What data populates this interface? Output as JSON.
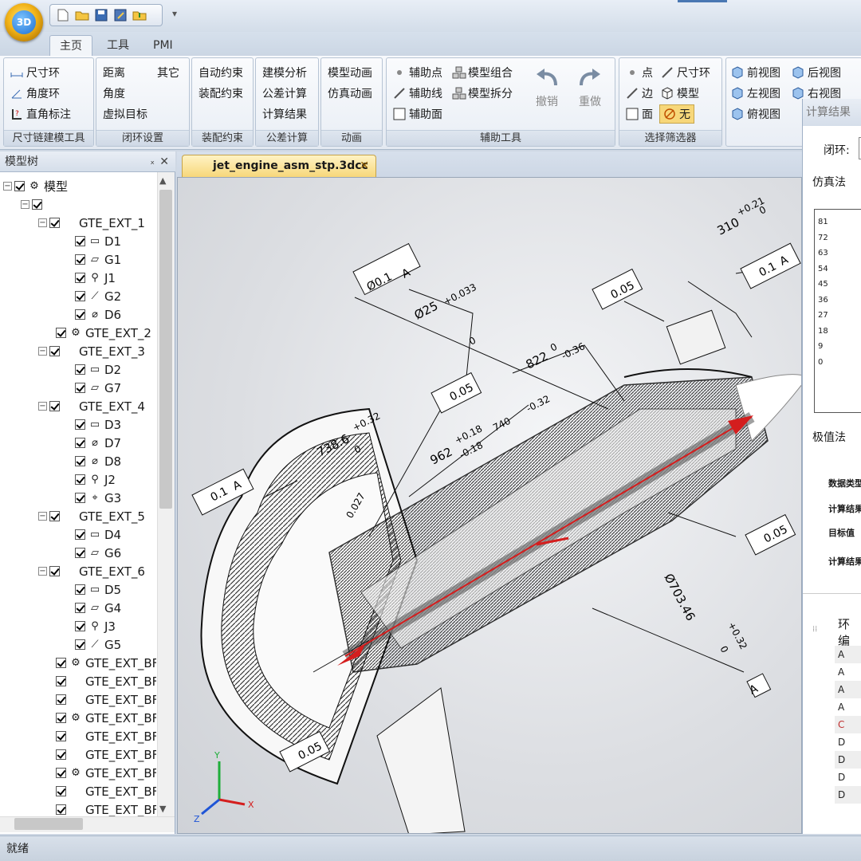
{
  "app": {
    "logo_text": "3D"
  },
  "qat": {
    "dropdown": "▾"
  },
  "tabs": [
    "主页",
    "工具",
    "PMI"
  ],
  "ribbon": {
    "groups": [
      {
        "label": "尺寸链建模工具",
        "items": [
          "尺寸环",
          "角度环",
          "直角标注"
        ]
      },
      {
        "label": "闭环设置",
        "items": [
          "距离",
          "其它",
          "角度",
          "虚拟目标"
        ]
      },
      {
        "label": "装配约束",
        "items": [
          "自动约束",
          "装配约束"
        ]
      },
      {
        "label": "公差计算",
        "items": [
          "建模分析",
          "公差计算",
          "计算结果"
        ]
      },
      {
        "label": "动画",
        "items": [
          "模型动画",
          "仿真动画"
        ]
      },
      {
        "label": "辅助工具",
        "items": [
          "辅助点",
          "模型组合",
          "辅助线",
          "模型拆分",
          "辅助面",
          "撤销",
          "重做"
        ]
      },
      {
        "label": "选择筛选器",
        "items": [
          "点",
          "尺寸环",
          "边",
          "模型",
          "面",
          "无"
        ]
      },
      {
        "label": "",
        "items": [
          "前视图",
          "后视图",
          "左视图",
          "右视图",
          "俯视图"
        ]
      }
    ]
  },
  "sidebar": {
    "title": "模型树",
    "pin": "ₓ",
    "close": "✕",
    "root": "模型",
    "nodes": [
      {
        "label": "GTE_EXT_1"
      },
      {
        "label": "D1"
      },
      {
        "label": "G1"
      },
      {
        "label": "J1"
      },
      {
        "label": "G2"
      },
      {
        "label": "D6"
      },
      {
        "label": "GTE_EXT_2"
      },
      {
        "label": "GTE_EXT_3"
      },
      {
        "label": "D2"
      },
      {
        "label": "G7"
      },
      {
        "label": "GTE_EXT_4"
      },
      {
        "label": "D3"
      },
      {
        "label": "D7"
      },
      {
        "label": "D8"
      },
      {
        "label": "J2"
      },
      {
        "label": "G3"
      },
      {
        "label": "GTE_EXT_5"
      },
      {
        "label": "D4"
      },
      {
        "label": "G6"
      },
      {
        "label": "GTE_EXT_6"
      },
      {
        "label": "D5"
      },
      {
        "label": "G4"
      },
      {
        "label": "J3"
      },
      {
        "label": "G5"
      },
      {
        "label": "GTE_EXT_BF"
      },
      {
        "label": "GTE_EXT_BF"
      },
      {
        "label": "GTE_EXT_BF"
      },
      {
        "label": "GTE_EXT_BF"
      },
      {
        "label": "GTE_EXT_BF"
      },
      {
        "label": "GTE_EXT_BF"
      },
      {
        "label": "GTE_EXT_BF"
      },
      {
        "label": "GTE_EXT_BF"
      },
      {
        "label": "GTE_EXT_BF"
      }
    ]
  },
  "document": {
    "tab_title": "jet_engine_asm_stp.3dcc",
    "close": "✕"
  },
  "annotations": {
    "pos_tol": "Ø0.1",
    "pos_datum": "A",
    "d25": "Ø25",
    "d25_up": "+0.033",
    "d25_lo": "0",
    "d822": "822",
    "d822_up": "0",
    "d822_lo": "-0.36",
    "d310": "310",
    "d310_up": "+0.21",
    "d310_lo": "0",
    "flat_005": "0.05",
    "par_01": "0.1",
    "par_datum": "A",
    "d738": "738.6",
    "d738_up": "+0.32",
    "d738_lo": "0",
    "d962": "962",
    "d962_up": "+0.18",
    "d962_lo": "-0.18",
    "d740": "740",
    "d740_up": "-0.32",
    "d027": "0.027",
    "d703": "Ø703.46",
    "d703_up": "+0.32",
    "d703_lo": "0",
    "datum_a": "A",
    "axis_x": "X",
    "axis_y": "Y",
    "axis_z": "Z"
  },
  "right_panel": {
    "title": "计算结果",
    "closed_loop_label": "闭环:",
    "sim_label": "仿真法",
    "y_ticks": [
      "81",
      "72",
      "63",
      "54",
      "45",
      "36",
      "27",
      "18",
      "9",
      "0"
    ],
    "extreme_label": "极值法",
    "table_rows": [
      "数据类型",
      "计算结果",
      "目标值",
      "计算结果"
    ],
    "ring_label": "环编",
    "list_items": [
      "A",
      "A",
      "A",
      "A",
      "C",
      "D",
      "D",
      "D",
      "D"
    ]
  },
  "status": {
    "text": "就绪"
  },
  "colors": {
    "accent": "#d41e1e",
    "ribbon_bg": "#e3e9f1",
    "tab_highlight": "#f7d77a"
  }
}
